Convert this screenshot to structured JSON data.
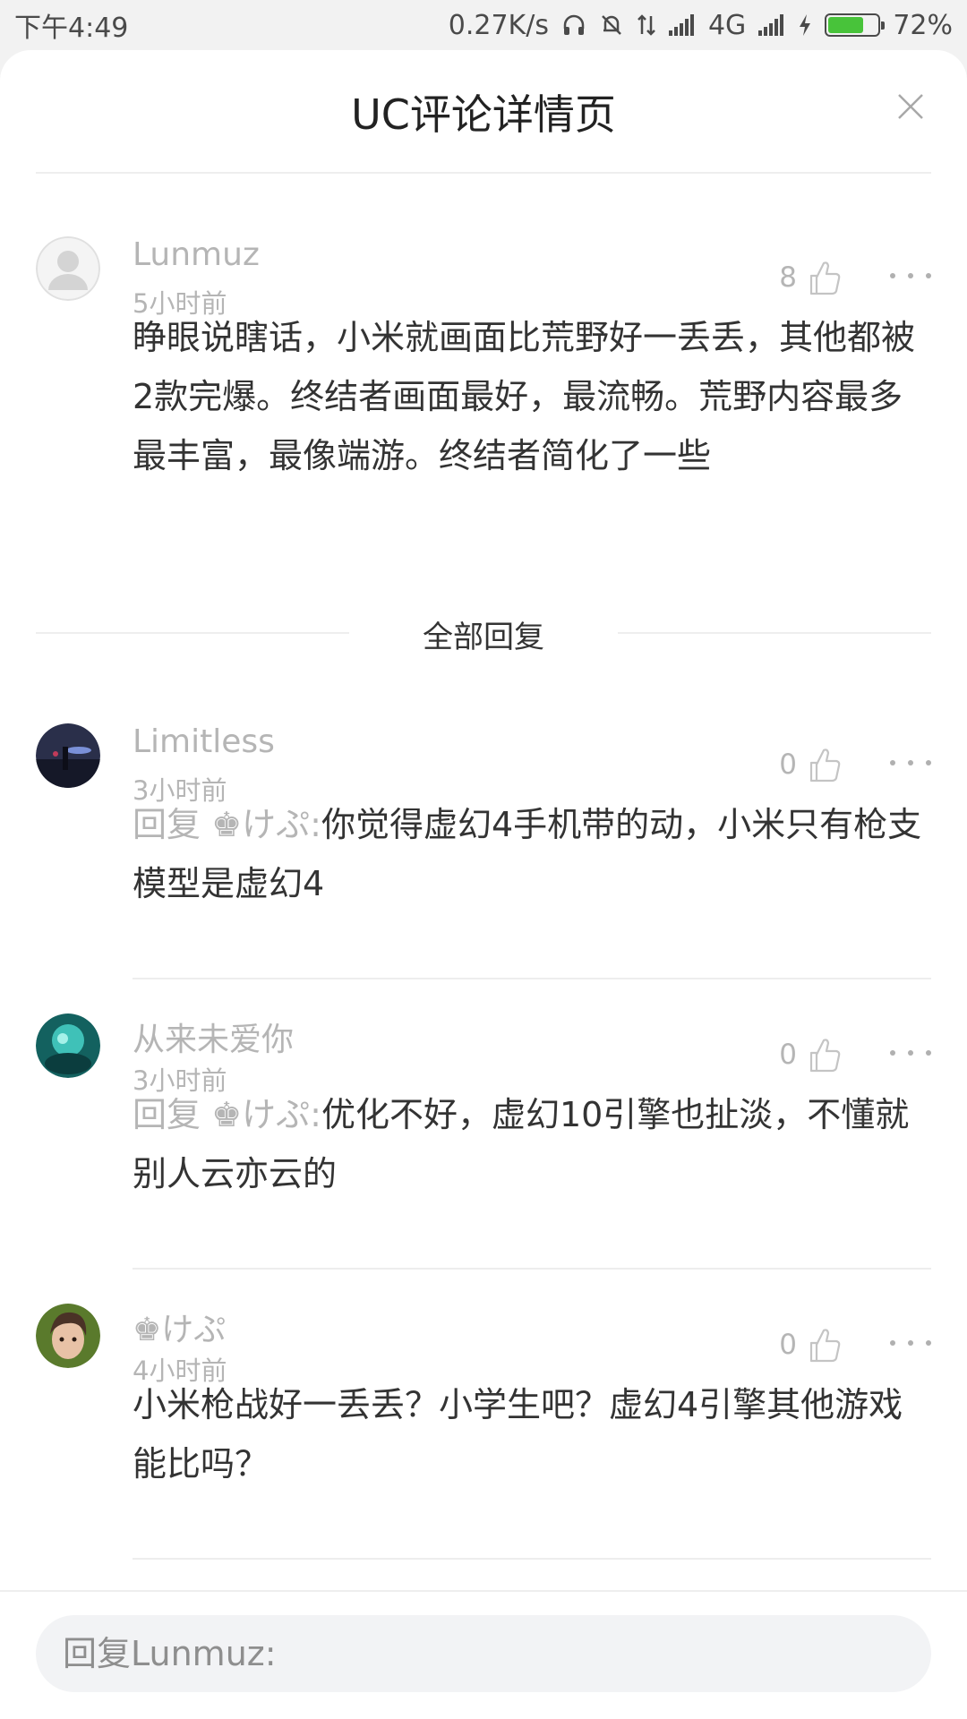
{
  "status_bar": {
    "time": "下午4:49",
    "speed": "0.27K/s",
    "network": "4G",
    "battery": "72%",
    "battery_level": 0.72
  },
  "sheet": {
    "title": "UC评论详情页"
  },
  "main_comment": {
    "username": "Lunmuz",
    "time": "5小时前",
    "likes": "8",
    "text": "睁眼说瞎话，小米就画面比荒野好一丢丢，其他都被2款完爆。终结者画面最好，最流畅。荒野内容最多最丰富，最像端游。终结者简化了一些"
  },
  "section": {
    "title": "全部回复"
  },
  "replies": [
    {
      "username": "Limitless",
      "time": "3小时前",
      "likes": "0",
      "reply_to": "回复 ♚けぷ:",
      "text": "你觉得虚幻4手机带的动，小米只有枪支模型是虚幻4"
    },
    {
      "username": "从来未爱你",
      "time": "3小时前",
      "likes": "0",
      "reply_to": "回复 ♚けぷ:",
      "text": "优化不好，虚幻10引擎也扯淡，不懂就别人云亦云的"
    },
    {
      "username": "♚けぷ",
      "time": "4小时前",
      "likes": "0",
      "reply_to": "",
      "text": "小米枪战好一丢丢？小学生吧？虚幻4引擎其他游戏能比吗？"
    }
  ],
  "reply_bar": {
    "placeholder": "回复Lunmuz:"
  }
}
